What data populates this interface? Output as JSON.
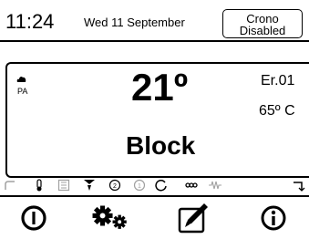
{
  "header": {
    "time": "11:24",
    "date": "Wed 11 September",
    "crono_line1": "Crono",
    "crono_line2": "Disabled"
  },
  "panel": {
    "mode_icon": "flame-icon",
    "mode_label": "PA",
    "temperature": "21º",
    "error_code": "Er.01",
    "water_temp": "65º C",
    "status": "Block"
  },
  "status_icons": [
    "auger-icon",
    "thermometer-icon",
    "resistance-icon",
    "fan-icon",
    "pump-2-icon",
    "pump-1-icon",
    "cycle-icon",
    "chain-icon",
    "heater-coil-icon",
    "exit-arrow-icon"
  ],
  "buttons": [
    "power-icon",
    "settings-gears-icon",
    "edit-pencil-icon",
    "info-icon"
  ],
  "colors": {
    "foreground": "#000000",
    "background": "#ffffff",
    "inactive": "#a0a0a0"
  }
}
